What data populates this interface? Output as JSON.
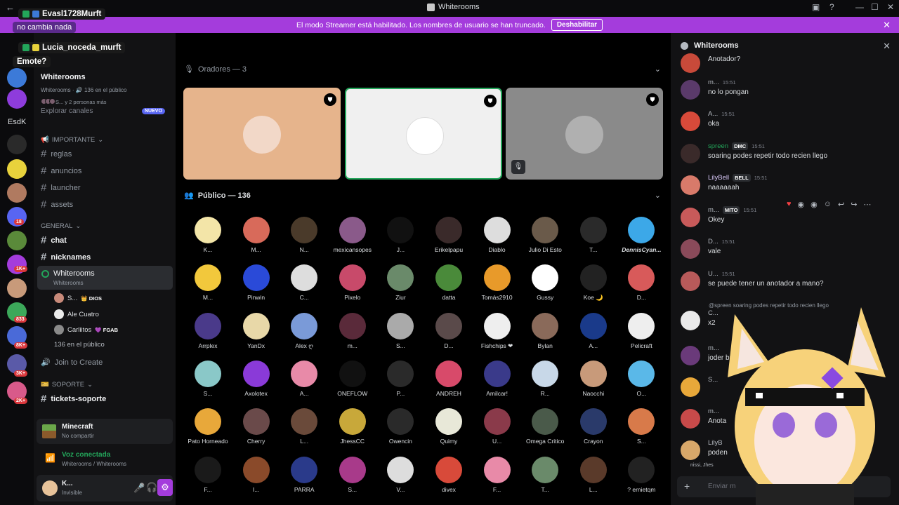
{
  "window": {
    "title": "Whiterooms",
    "back": "←",
    "minimize": "—",
    "maximize": "☐",
    "close": "✕",
    "inbox": "▣",
    "help": "?"
  },
  "banner": {
    "text": "El modo Streamer está habilitado. Los nombres de usuario se han truncado.",
    "button": "Deshabilitar",
    "close": "✕"
  },
  "overlay": {
    "msg1_user": "Evasl1728Murft",
    "msg1_text": "no cambia nada",
    "msg2_user": "Lucia_noceda_murft",
    "msg2_text": "Emote?"
  },
  "rail": {
    "label_esdk": "EsdK",
    "badges": [
      "18",
      "1K+",
      "833",
      "8K+",
      "3K+",
      "2K+"
    ]
  },
  "sidebar": {
    "guild_name": "Whiterooms",
    "guild_sub": "Whiterooms · 🔊 136 en el público",
    "guild_sub2": "S... y 2 personas más",
    "explore": "Explorar canales",
    "nuevo": "NUEVO",
    "cat_important": "IMPORTANTE",
    "cat_general": "GENERAL",
    "cat_support": "SOPORTE",
    "ch_reglas": "reglas",
    "ch_anuncios": "anuncios",
    "ch_launcher": "launcher",
    "ch_assets": "assets",
    "ch_chat": "chat",
    "ch_nicknames": "nicknames",
    "ch_whiterooms": "Whiterooms",
    "ch_whiterooms_sub": "Whiterooms",
    "vm1_name": "S...",
    "vm1_tag": "👑 DIOS",
    "vm2_name": "Ale Cuatro",
    "vm3_name": "Carliitos",
    "vm3_tag": "💜 FGAB",
    "audience_count": "136 en el público",
    "join": "Join to Create",
    "ch_tickets": "tickets-soporte",
    "hash": "#",
    "mc_title": "Minecraft",
    "mc_sub": "No compartir",
    "vc_title": "Voz conectada",
    "vc_sub": "Whiterooms / Whiterooms",
    "user_name": "K...",
    "user_status": "Invisible"
  },
  "main": {
    "speakers_header": "Oradores — 3",
    "audience_header": "Público — 136",
    "chevron": "⌄",
    "audience": [
      "K...",
      "M...",
      "N...",
      "mexicansopes",
      "J...",
      "Erikelpapu",
      "Diablo",
      "Julio Di Esto",
      "T...",
      "DennisCyan...",
      "M...",
      "Pinwin",
      "C...",
      "Pixelo",
      "Ziur",
      "datta",
      "Tomás2910",
      "Gussy",
      "Koe 🌙",
      "D...",
      "Arrplex",
      "YanDx",
      "Alex ღ",
      "m...",
      "S...",
      "D...",
      "Fishchips ❤",
      "Bylan",
      "A...",
      "Pelicraft",
      "S...",
      "Axolotex",
      "A...",
      "ONEFLOW",
      "P...",
      "ANDREH",
      "Amilcar!",
      "R...",
      "Naocchi",
      "O...",
      "Pato Horneado",
      "Cherry",
      "L...",
      "JhessCC",
      "Owencin",
      "Quimy",
      "U...",
      "Omega Critico",
      "Crayon",
      "S...",
      "F...",
      "I...",
      "PARRA",
      "S...",
      "V...",
      "divex",
      "F...",
      "T...",
      "L...",
      "? ernietqm"
    ]
  },
  "chat": {
    "title": "Whiterooms",
    "close": "✕",
    "messages": [
      {
        "name": "",
        "tag": "",
        "time": "",
        "text": "Anotador?"
      },
      {
        "name": "m...",
        "tag": "",
        "time": "15:51",
        "text": "no lo pongan"
      },
      {
        "name": "A...",
        "tag": "",
        "time": "15:51",
        "text": "oka"
      },
      {
        "name": "spreen",
        "tag": "DMC",
        "time": "15:51",
        "text": "soaring podes repetir todo recien llego"
      },
      {
        "name": "LilyBell",
        "tag": "BELL",
        "time": "15:51",
        "text": "naaaaaah"
      },
      {
        "name": "m...",
        "tag": "MITO",
        "time": "15:51",
        "text": "Okey"
      },
      {
        "name": "D...",
        "tag": "",
        "time": "15:51",
        "text": "vale"
      },
      {
        "name": "U...",
        "tag": "",
        "time": "15:51",
        "text": "se puede tener un anotador a mano?"
      },
      {
        "name": "C...",
        "tag": "",
        "time": "",
        "text": "x2"
      },
      {
        "name": "m...",
        "tag": "",
        "time": "",
        "text": "joder bro"
      },
      {
        "name": "S...",
        "tag": "",
        "time": "",
        "text": ""
      },
      {
        "name": "m...",
        "tag": "",
        "time": "",
        "text": "Anota"
      },
      {
        "name": "LilyB",
        "tag": "",
        "time": "",
        "text": "poden"
      }
    ],
    "reply_preview": "@spreen  soaring podes repetir todo recien llego",
    "typing": "nissi, Jhes",
    "input_placeholder": "Enviar m",
    "plus": "+"
  }
}
